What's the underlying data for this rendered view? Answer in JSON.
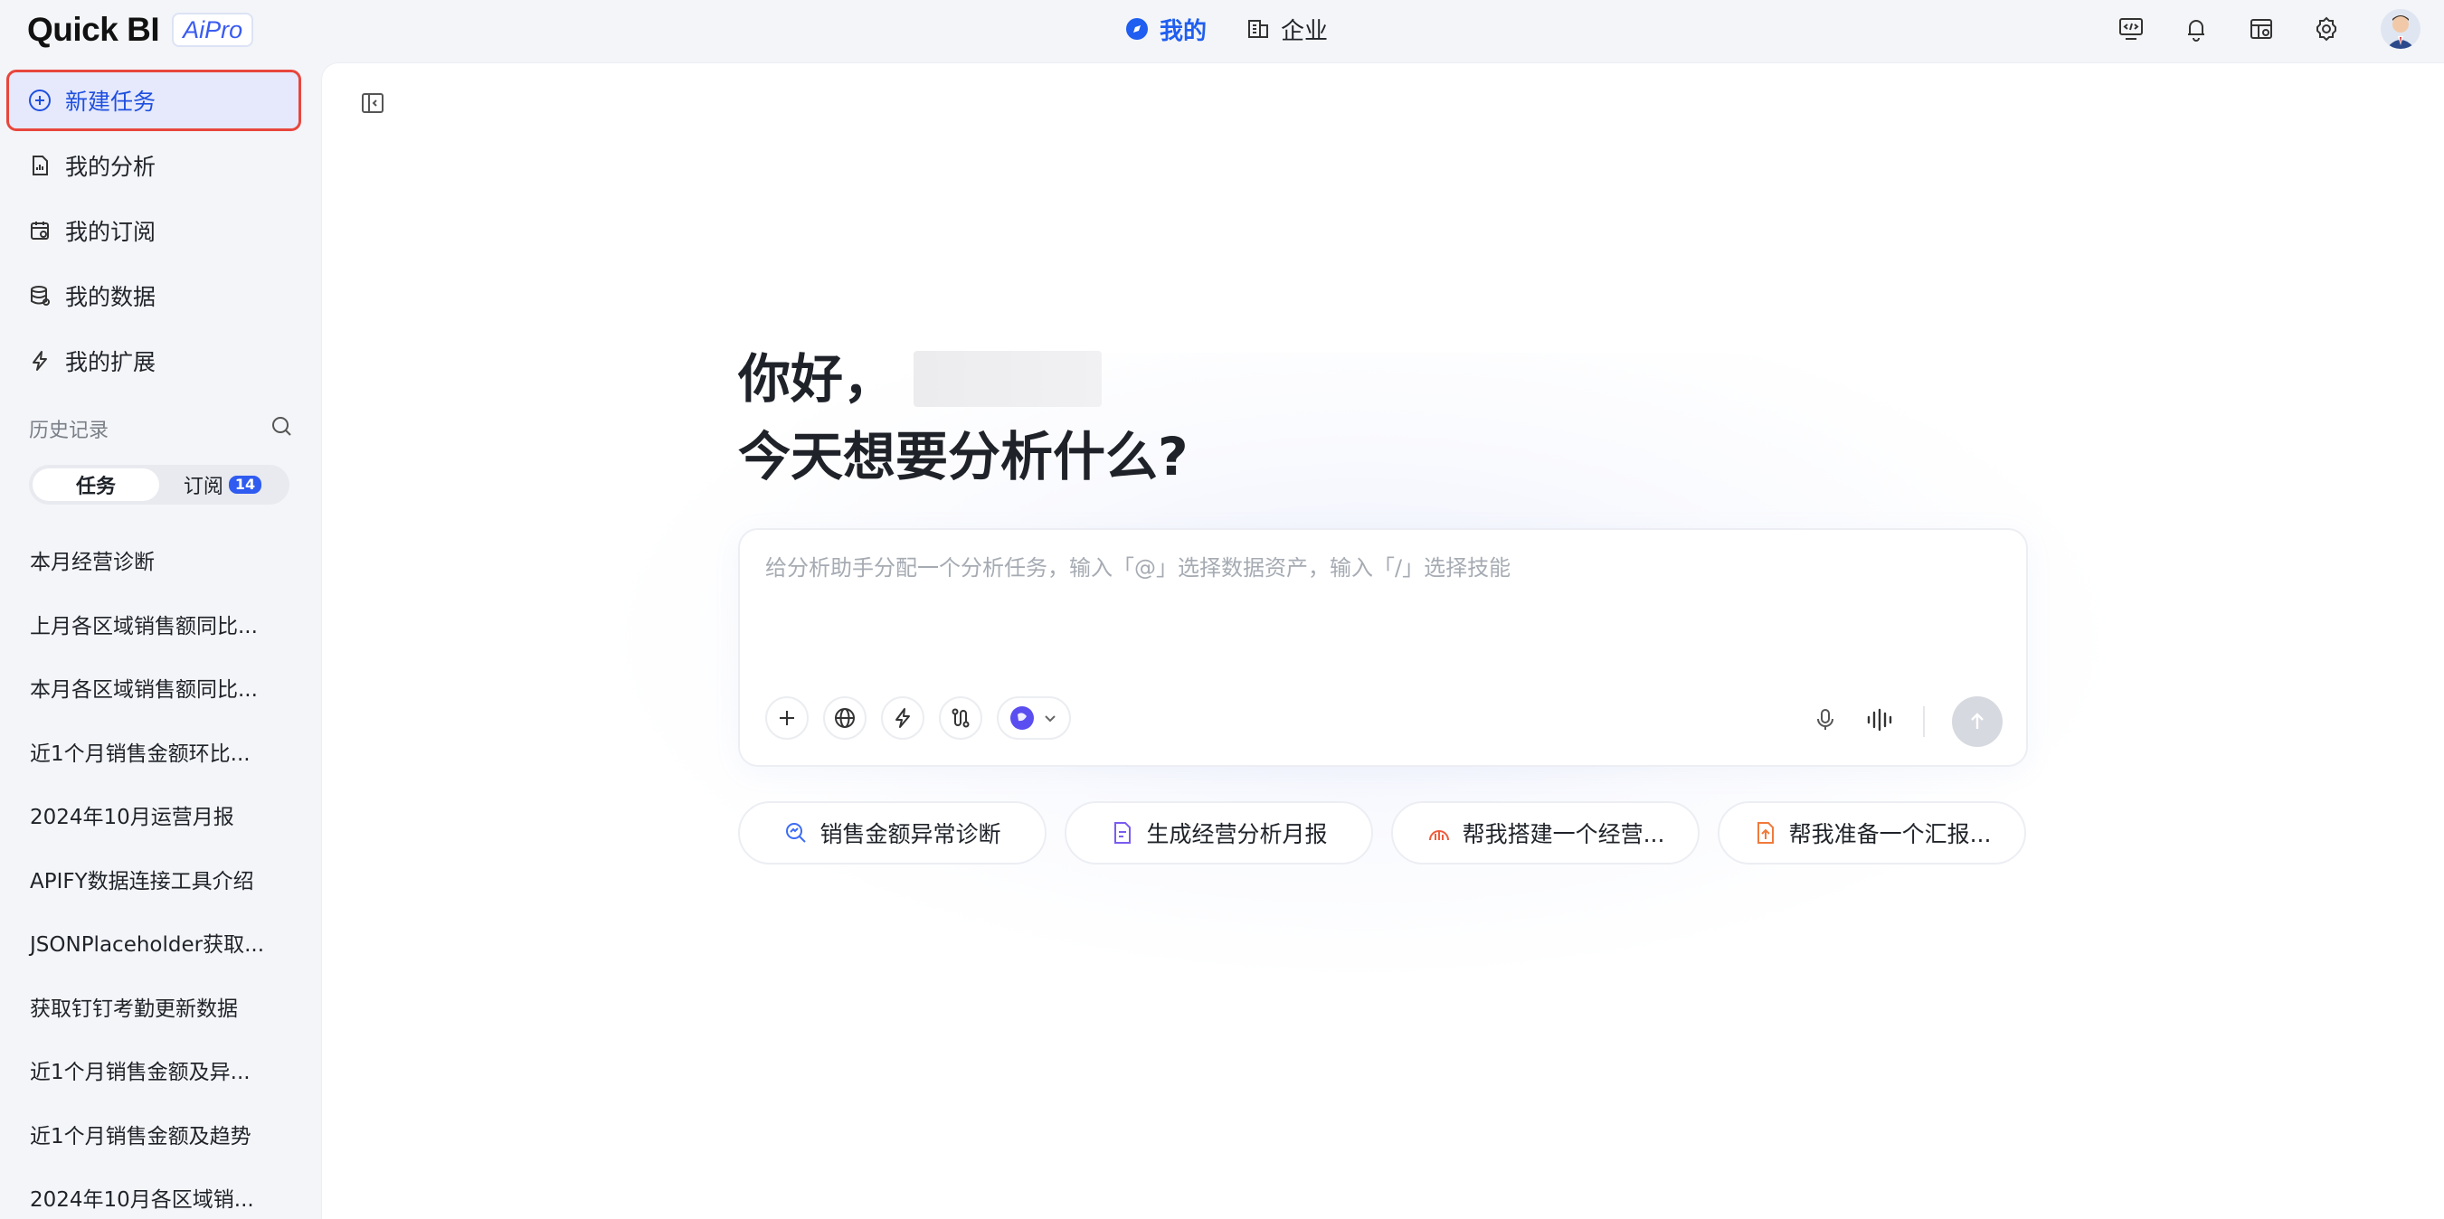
{
  "brand": {
    "name": "Quick BI",
    "badge": "AiPro",
    "accent": "#1f5ef0"
  },
  "top_tabs": [
    {
      "label": "我的",
      "icon": "compass-icon",
      "active": true
    },
    {
      "label": "企业",
      "icon": "building-icon",
      "active": false
    }
  ],
  "top_icons": [
    "code-monitor-icon",
    "bell-icon",
    "dashboard-icon",
    "gear-icon",
    "avatar"
  ],
  "sidebar": {
    "nav": [
      {
        "label": "新建任务",
        "icon": "plus-circle-icon",
        "active": true
      },
      {
        "label": "我的分析",
        "icon": "document-chart-icon"
      },
      {
        "label": "我的订阅",
        "icon": "calendar-icon"
      },
      {
        "label": "我的数据",
        "icon": "database-icon"
      },
      {
        "label": "我的扩展",
        "icon": "lightning-icon"
      }
    ],
    "history_label": "历史记录",
    "segments": [
      {
        "label": "任务",
        "active": true
      },
      {
        "label": "订阅",
        "badge": "14"
      }
    ],
    "history": [
      "本月经营诊断",
      "上月各区域销售额同比...",
      "本月各区域销售额同比...",
      "近1个月销售金额环比...",
      "2024年10月运营月报",
      "APIFY数据连接工具介绍",
      "JSONPlaceholder获取...",
      "获取钉钉考勤更新数据",
      "近1个月销售金额及异...",
      "近1个月销售金额及趋势",
      "2024年10月各区域销..."
    ]
  },
  "main": {
    "greeting_line1": "你好，",
    "greeting_line2": "今天想要分析什么?",
    "input_placeholder": "给分析助手分配一个分析任务，输入「@」选择数据资产，输入「/」选择技能",
    "suggestions": [
      {
        "label": "销售金额异常诊断",
        "icon": "diagnose-icon",
        "color": "#3b6cf5"
      },
      {
        "label": "生成经营分析月报",
        "icon": "report-icon",
        "color": "#7a5cf0"
      },
      {
        "label": "帮我搭建一个经营...",
        "icon": "build-icon",
        "color": "#f05b3b"
      },
      {
        "label": "帮我准备一个汇报...",
        "icon": "upload-doc-icon",
        "color": "#f07a3b"
      }
    ]
  }
}
